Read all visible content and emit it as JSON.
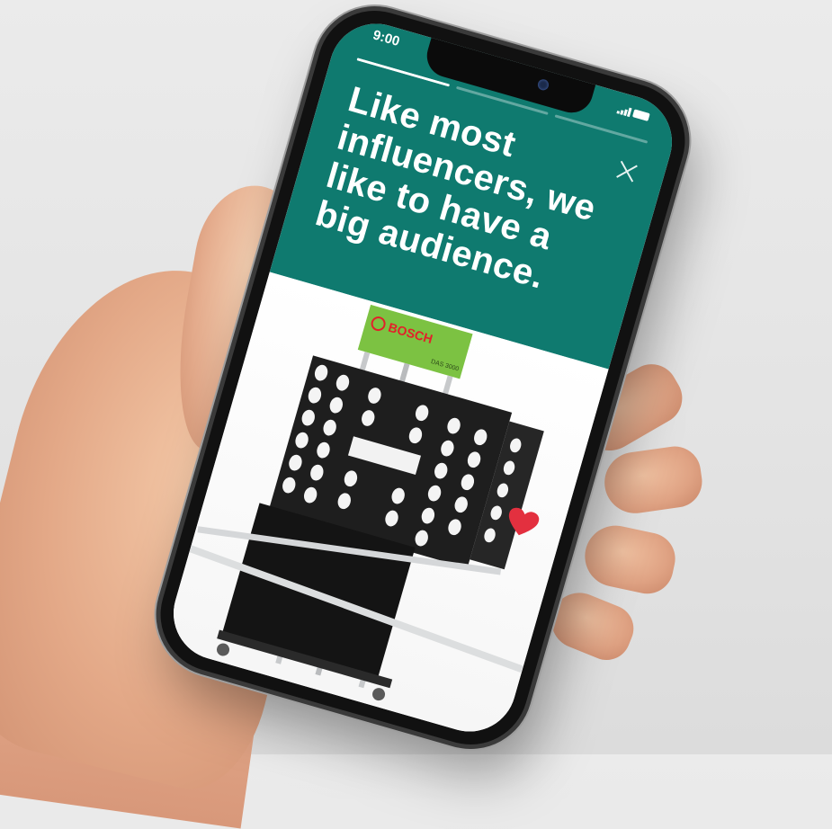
{
  "status": {
    "time": "9:00"
  },
  "story": {
    "segments": [
      {
        "progress": 1.0
      },
      {
        "progress": 0.0
      },
      {
        "progress": 0.0
      }
    ],
    "headline": "Like most influencers, we like to have a big audience.",
    "close_icon": "close-icon",
    "like_icon": "heart-icon"
  },
  "product": {
    "brand": "BOSCH",
    "model": "DAS 3000"
  },
  "colors": {
    "header_bg": "#0f7a6f",
    "brand_green": "#7cc242",
    "brand_red": "#e3202a",
    "heart": "#e3303f"
  }
}
